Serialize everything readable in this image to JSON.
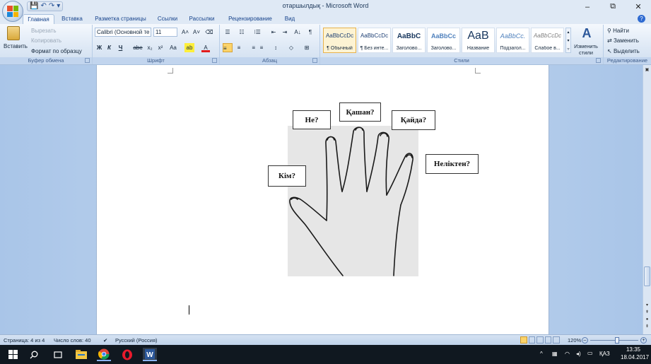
{
  "window": {
    "title": "отаршылдық - Microsoft Word",
    "minimize": "–",
    "restore": "⧉",
    "close": "✕"
  },
  "qat": {
    "save": "💾",
    "undo": "↶",
    "redo": "↷",
    "more": "▾"
  },
  "tabs": [
    "Главная",
    "Вставка",
    "Разметка страницы",
    "Ссылки",
    "Рассылки",
    "Рецензирование",
    "Вид"
  ],
  "help": "?",
  "ribbon": {
    "clipboard": {
      "label": "Буфер обмена",
      "paste": "Вставить",
      "cut": "Вырезать",
      "copy": "Копировать",
      "format_painter": "Формат по образцу"
    },
    "font": {
      "label": "Шрифт",
      "font_name": "Calibri (Основной те",
      "font_size": "11",
      "grow": "A˄",
      "shrink": "A˅",
      "clear": "⌫",
      "bold": "Ж",
      "italic": "К",
      "underline": "Ч",
      "strike": "abe",
      "subscript": "x₂",
      "superscript": "x²",
      "case": "Aa",
      "highlight": "ab",
      "color": "A"
    },
    "paragraph": {
      "label": "Абзац",
      "bullets": "☰",
      "numbering": "☷",
      "multilevel": "⁝☰",
      "decrease_indent": "⇤",
      "increase_indent": "⇥",
      "sort": "A↓",
      "pilcrow": "¶",
      "align_left": "≡",
      "align_center": "≡",
      "align_right": "≡",
      "justify": "≡",
      "line_spacing": "↕",
      "shading": "◇",
      "borders": "⊞"
    },
    "styles": {
      "label": "Стили",
      "items": [
        {
          "sample": "AaBbCcDc",
          "name": "¶ Обычный"
        },
        {
          "sample": "AaBbCcDc",
          "name": "¶ Без инте..."
        },
        {
          "sample": "AaBbC",
          "name": "Заголово..."
        },
        {
          "sample": "AaBbCc",
          "name": "Заголово..."
        },
        {
          "sample": "AaB",
          "name": "Название"
        },
        {
          "sample": "AaBbCc.",
          "name": "Подзагол..."
        },
        {
          "sample": "AaBbCcDc",
          "name": "Слабое в..."
        }
      ],
      "change_styles": "Изменить стили"
    },
    "editing": {
      "label": "Редактирование",
      "find": "Найти",
      "replace": "Заменить",
      "select": "Выделить"
    }
  },
  "document": {
    "questions": {
      "what": "Не?",
      "when": "Қашан?",
      "where": "Қайда?",
      "who": "Кім?",
      "why": "Неліктен?"
    }
  },
  "status": {
    "page": "Страница: 4 из 4",
    "words": "Число слов: 40",
    "language": "Русский (Россия)",
    "zoom": "120%"
  },
  "taskbar": {
    "lang": "ҚАЗ",
    "time": "13:35",
    "date": "18.04.2017"
  }
}
